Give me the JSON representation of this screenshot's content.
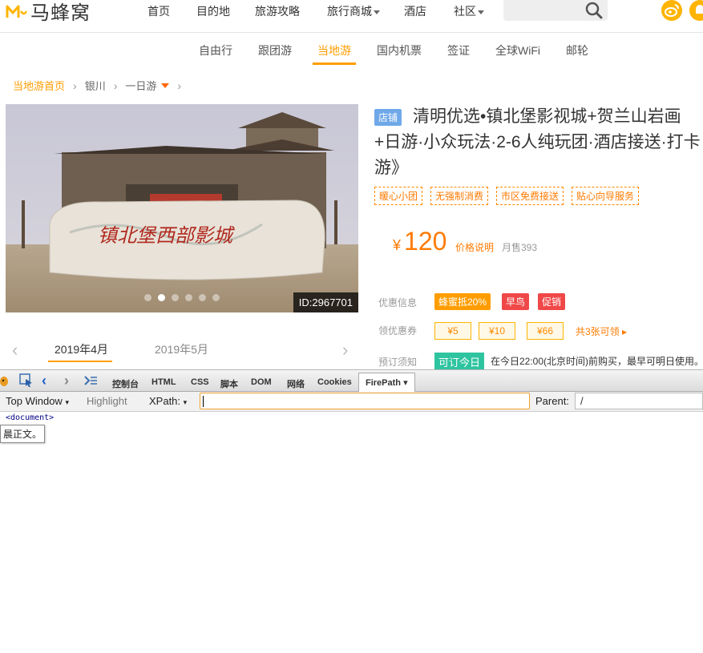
{
  "header": {
    "brand": "马蜂窝",
    "nav": [
      {
        "label": "首页",
        "caret": false
      },
      {
        "label": "目的地",
        "caret": false
      },
      {
        "label": "旅游攻略",
        "caret": false
      },
      {
        "label": "旅行商城",
        "caret": true
      },
      {
        "label": "酒店",
        "caret": false
      },
      {
        "label": "社区",
        "caret": true
      }
    ],
    "search_icon": "search-icon",
    "right_icons": [
      "weibo-icon",
      "notification-icon"
    ]
  },
  "subnav": {
    "items": [
      "自由行",
      "跟团游",
      "当地游",
      "国内机票",
      "签证",
      "全球WiFi",
      "邮轮"
    ],
    "active": "当地游"
  },
  "breadcrumb": {
    "home": "当地游首页",
    "city": "银川",
    "category": "一日游"
  },
  "gallery": {
    "id_label": "ID:2967701",
    "dot_count": 6,
    "active_dot": 1,
    "sign_text": "镇北堡西部影城"
  },
  "calendar": {
    "tabs": [
      "2019年4月",
      "2019年5月"
    ],
    "active": "2019年4月"
  },
  "product": {
    "badge": "店铺",
    "title": "清明优选•镇北堡影视城+贺兰山岩画+日游·小众玩法·2-6人纯玩团·酒店接送·打卡游》",
    "tags": [
      "暖心小团",
      "无强制消费",
      "市区免费接送",
      "贴心向导服务"
    ],
    "price_symbol": "¥",
    "price": "120",
    "price_note": "价格说明",
    "sold": "月售393",
    "promo_label": "优惠信息",
    "promos": [
      {
        "text": "蜂蜜抵20%",
        "color": "#ff9d00"
      },
      {
        "text": "早鸟",
        "color": "#f04848"
      },
      {
        "text": "促销",
        "color": "#f04848"
      }
    ],
    "coupon_label": "领优惠券",
    "coupons": [
      "¥5",
      "¥10",
      "¥66"
    ],
    "coupon_more": "共3张可领",
    "booking_label": "预订须知",
    "bookable": "可订今日",
    "booking_text": "在今日22:00(北京时间)前购买，最早可明日使用。"
  },
  "firebug": {
    "tabs": [
      "控制台",
      "HTML",
      "CSS",
      "脚本",
      "DOM",
      "网络",
      "Cookies",
      "FirePath"
    ],
    "active_tab": "FirePath",
    "top_window": "Top Window",
    "highlight": "Highlight",
    "xpath_label": "XPath:",
    "xpath_value": "",
    "parent_label": "Parent:",
    "parent_value": "/",
    "doc_node": "<document>",
    "tooltip": "晨正文。"
  }
}
